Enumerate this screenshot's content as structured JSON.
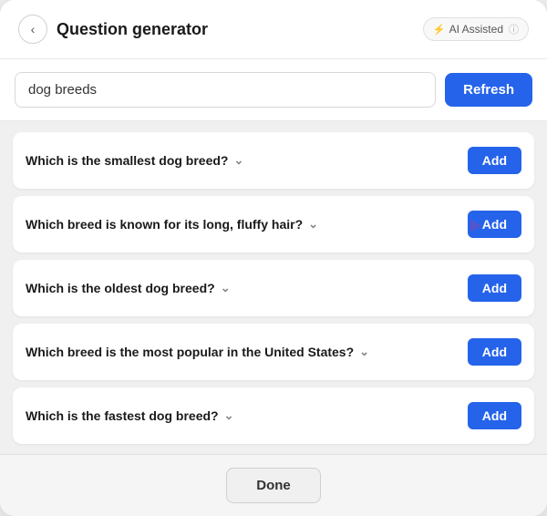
{
  "header": {
    "title": "Question generator",
    "back_label": "<",
    "ai_badge_label": "AI Assisted",
    "ai_badge_icon": "⚡"
  },
  "search": {
    "value": "dog breeds",
    "placeholder": "dog breeds",
    "refresh_label": "Refresh"
  },
  "questions": [
    {
      "id": 1,
      "text": "Which is the smallest dog breed?",
      "add_label": "Add"
    },
    {
      "id": 2,
      "text": "Which breed is known for its long, fluffy hair?",
      "add_label": "Add"
    },
    {
      "id": 3,
      "text": "Which is the oldest dog breed?",
      "add_label": "Add"
    },
    {
      "id": 4,
      "text": "Which breed is the most popular in the United States?",
      "add_label": "Add"
    },
    {
      "id": 5,
      "text": "Which is the fastest dog breed?",
      "add_label": "Add"
    }
  ],
  "footer": {
    "done_label": "Done"
  }
}
